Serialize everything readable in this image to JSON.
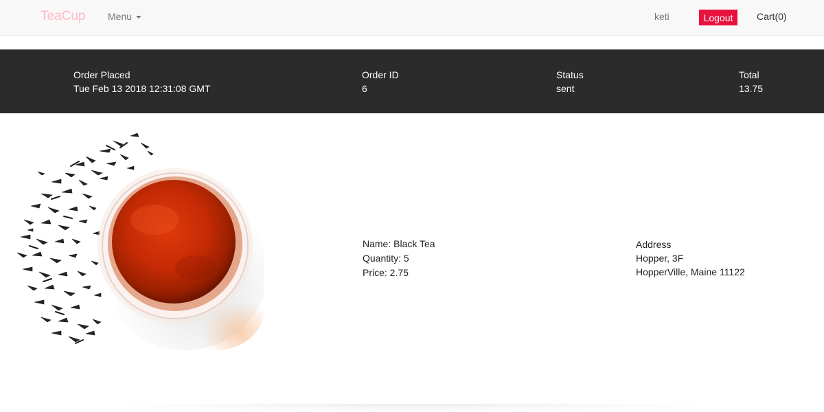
{
  "navbar": {
    "brand": "TeaCup",
    "menu_label": "Menu",
    "username": "keti",
    "logout_label": "Logout",
    "cart_label": "Cart(0)",
    "brand_color": "#ffb8c6",
    "logout_color": "#e8123f"
  },
  "order": {
    "placed_label": "Order Placed",
    "placed_value": "Tue Feb 13 2018 12:31:08 GMT",
    "id_label": "Order ID",
    "id_value": "6",
    "status_label": "Status",
    "status_value": "sent",
    "total_label": "Total",
    "total_value": "13.75",
    "bar_color": "#2b2b2b"
  },
  "item": {
    "image_icon": "black-tea-cup-image",
    "name": "Name: Black Tea",
    "quantity": "Quantity: 5",
    "price": "Price: 2.75"
  },
  "address": {
    "label": "Address",
    "line1": "Hopper, 3F",
    "line2": "HopperVille, Maine 11122"
  }
}
